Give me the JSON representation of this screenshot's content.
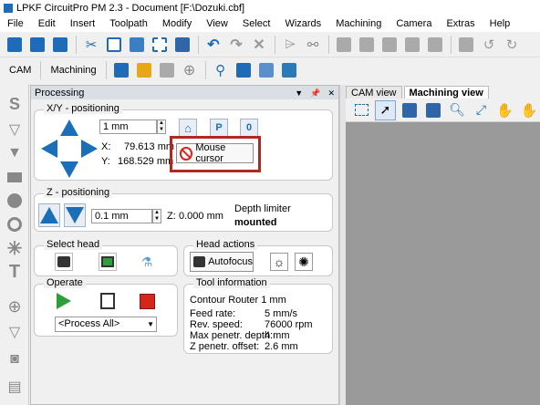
{
  "window": {
    "title": "LPKF CircuitPro PM 2.3 - Document [F:\\Dozuki.cbf]"
  },
  "menu": [
    "File",
    "Edit",
    "Insert",
    "Toolpath",
    "Modify",
    "View",
    "Select",
    "Wizards",
    "Machining",
    "Camera",
    "Extras",
    "Help"
  ],
  "toolbar2": {
    "mode_label": "CAM",
    "machining_label": "Machining"
  },
  "panel": {
    "title": "Processing"
  },
  "xy": {
    "title": "X/Y - positioning",
    "step_value": "1 mm",
    "x_label": "X:",
    "x_value": "79.613 mm",
    "y_label": "Y:",
    "y_value": "168.529 mm",
    "mouse_cursor_label": "Mouse cursor"
  },
  "z": {
    "title": "Z - positioning",
    "step_value": "0.1 mm",
    "z_label": "Z:",
    "z_value": "0.000 mm",
    "depth_limiter_label": "Depth limiter",
    "depth_limiter_status": "mounted"
  },
  "select_head": {
    "title": "Select head"
  },
  "head_actions": {
    "title": "Head actions",
    "autofocus_label": "Autofocus"
  },
  "operate": {
    "title": "Operate",
    "process_select": "<Process All>"
  },
  "tool_info": {
    "title": "Tool information",
    "tool_name": "Contour Router 1 mm",
    "rows": [
      {
        "label": "Feed rate:",
        "value": "5 mm/s"
      },
      {
        "label": "Rev. speed:",
        "value": "76000 rpm"
      },
      {
        "label": "Max penetr. depth:",
        "value": "4 mm"
      },
      {
        "label": "Z penetr. offset:",
        "value": "2.6 mm"
      }
    ]
  },
  "views": {
    "tabs": [
      "CAM view",
      "Machining view"
    ],
    "active": "Machining view"
  },
  "colors": {
    "accent_blue": "#1a6fb8",
    "highlight_red": "#b0281f",
    "canvas_gray": "#9a9a9a",
    "play_green": "#2e9e3a",
    "stop_red": "#d8251c"
  }
}
